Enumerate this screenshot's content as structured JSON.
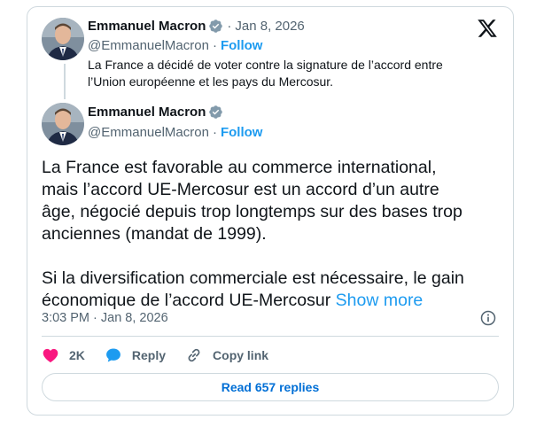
{
  "quoted": {
    "author_name": "Emmanuel Macron",
    "date": "Jan 8, 2026",
    "handle": "@EmmanuelMacron",
    "follow_label": "Follow",
    "text": "La France a décidé de voter contre la signature de l’accord entre l’Union européenne et les pays du Mercosur."
  },
  "main": {
    "author_name": "Emmanuel Macron",
    "handle": "@EmmanuelMacron",
    "follow_label": "Follow",
    "paragraph_1": "La France est favorable au commerce international, mais l’accord UE-Mercosur est un accord d’un autre âge, négocié depuis trop longtemps sur des bases trop anciennes (mandat de 1999).",
    "paragraph_2": "Si la diversification commerciale est nécessaire, le gain économique de l’accord UE-Mercosur ",
    "show_more": "Show more",
    "timestamp": "3:03 PM · Jan 8, 2026"
  },
  "separator": "·",
  "actions": {
    "like_count": "2K",
    "reply_label": "Reply",
    "copy_link_label": "Copy link"
  },
  "read_replies_label": "Read 657 replies",
  "icons": {
    "verified": "verified-badge-icon",
    "x_logo": "x-logo-icon",
    "info": "info-icon",
    "like": "heart-icon",
    "reply": "speech-bubble-icon",
    "copy_link": "link-icon"
  },
  "colors": {
    "accent": "#1d9bf0",
    "link_dark": "#006fd6",
    "like": "#f91880",
    "secondary_text": "#536471",
    "border": "#cfd9de"
  }
}
